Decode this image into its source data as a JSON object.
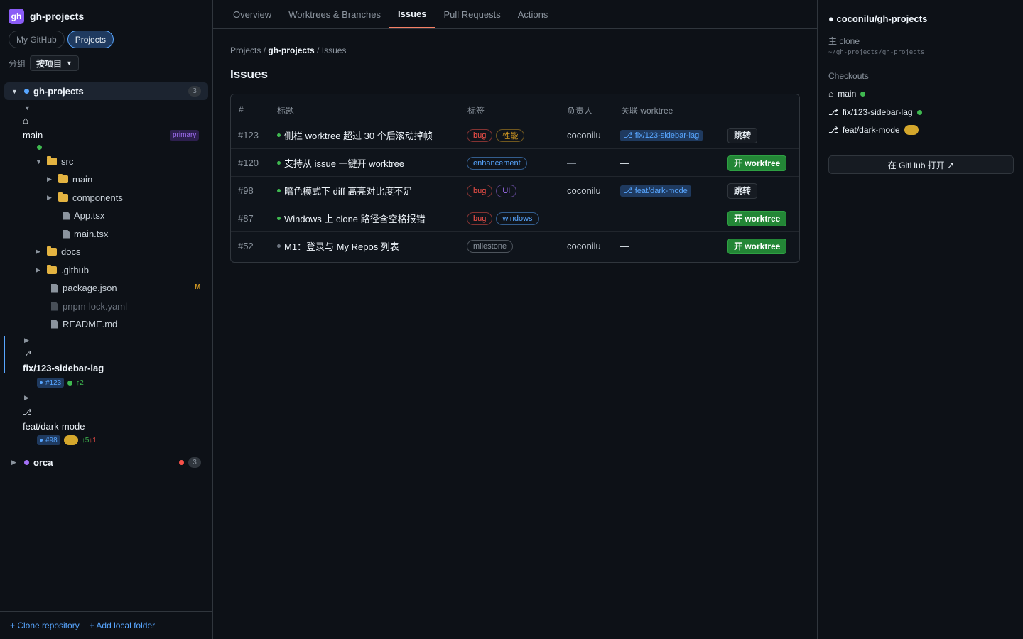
{
  "sidebar": {
    "brand": {
      "logo": "gh",
      "title": "gh-projects"
    },
    "segments": [
      {
        "label": "My GitHub"
      },
      {
        "label": "Projects"
      }
    ],
    "group": {
      "label": "分组",
      "value": "按项目"
    },
    "repos": [
      {
        "name": "gh-projects",
        "count": "3"
      },
      {
        "name": "orca",
        "count": "3"
      }
    ],
    "main_worktree": {
      "home_glyph": "⌂",
      "branch": "main",
      "badge": "primary"
    },
    "files": [
      {
        "name": "src"
      },
      {
        "name": "main"
      },
      {
        "name": "components"
      },
      {
        "name": "App.tsx"
      },
      {
        "name": "main.tsx"
      },
      {
        "name": "docs"
      },
      {
        "name": ".github"
      },
      {
        "name": "package.json",
        "badge": "M"
      },
      {
        "name": "pnpm-lock.yaml"
      },
      {
        "name": "README.md"
      }
    ],
    "worktrees": [
      {
        "glyph": "⎇",
        "branch": "fix/123-sidebar-lag",
        "issue": "#123",
        "ahead": "↑2"
      },
      {
        "glyph": "⎇",
        "branch": "feat/dark-mode",
        "issue": "#98",
        "ahead": "↑5",
        "behind": "↓1"
      }
    ],
    "footer": {
      "clone": "+ Clone repository",
      "add_folder": "+ Add local folder"
    }
  },
  "main": {
    "tabs": [
      {
        "label": "Overview"
      },
      {
        "label": "Worktrees & Branches"
      },
      {
        "label": "Issues"
      },
      {
        "label": "Pull Requests"
      },
      {
        "label": "Actions"
      }
    ],
    "breadcrumb": {
      "root": "Projects",
      "sep": " / ",
      "repo": "gh-projects",
      "page": "Issues"
    },
    "title": "Issues",
    "table": {
      "headers": [
        "#",
        "标题",
        "标签",
        "负责人",
        "关联 worktree"
      ],
      "rows": [
        {
          "num": "#123",
          "title": "侧栏 worktree 超过 30 个后滚动掉帧",
          "state": "open",
          "labels": [
            {
              "text": "bug",
              "color": "#f85149"
            },
            {
              "text": "性能",
              "color": "#d29922"
            }
          ],
          "assignee": "coconilu",
          "worktree": "⎇ fix/123-sidebar-lag",
          "action": "跳转"
        },
        {
          "num": "#120",
          "title": "支持从 issue 一键开 worktree",
          "state": "open",
          "labels": [
            {
              "text": "enhancement",
              "color": "#58a6ff"
            }
          ],
          "assignee": "—",
          "worktree": "—",
          "action": "开 worktree"
        },
        {
          "num": "#98",
          "title": "暗色模式下 diff 高亮对比度不足",
          "state": "open",
          "labels": [
            {
              "text": "bug",
              "color": "#f85149"
            },
            {
              "text": "UI",
              "color": "#a371f7"
            }
          ],
          "assignee": "coconilu",
          "worktree": "⎇ feat/dark-mode",
          "action": "跳转"
        },
        {
          "num": "#87",
          "title": "Windows 上 clone 路径含空格报错",
          "state": "open",
          "labels": [
            {
              "text": "bug",
              "color": "#f85149"
            },
            {
              "text": "windows",
              "color": "#58a6ff"
            }
          ],
          "assignee": "—",
          "worktree": "—",
          "action": "开 worktree"
        },
        {
          "num": "#52",
          "title": "M1：登录与 My Repos 列表",
          "state": "closed",
          "labels": [
            {
              "text": "milestone",
              "color": "#8b949e"
            }
          ],
          "assignee": "coconilu",
          "worktree": "—",
          "action": "开 worktree"
        }
      ]
    }
  },
  "right": {
    "title": "● coconilu/gh-projects",
    "clone_label": "主 clone",
    "clone_path": "~/gh-projects/gh-projects",
    "checkouts_label": "Checkouts",
    "checkouts": [
      {
        "glyph": "⌂",
        "name": "main",
        "status": "clean"
      },
      {
        "glyph": "⎇",
        "name": "fix/123-sidebar-lag",
        "status": "clean"
      },
      {
        "glyph": "⎇",
        "name": "feat/dark-mode",
        "status": "dirty"
      }
    ],
    "open_github": "在 GitHub 打开 ↗"
  },
  "colors": {
    "accent": "#58a6ff",
    "success": "#238636",
    "brand": "#8b5cf6",
    "tab_underline": "#f78166"
  }
}
